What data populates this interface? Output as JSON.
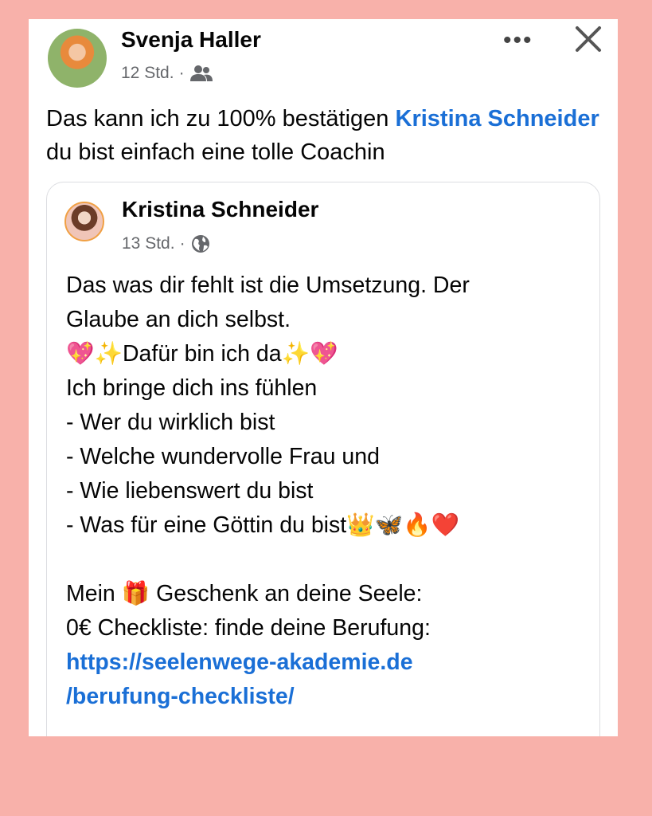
{
  "post": {
    "author": "Svenja Haller",
    "time": "12 Std.",
    "separator": "·",
    "audience_icon": "friends-icon",
    "more_icon": "more-horizontal-icon",
    "more_label": "•••",
    "close_icon": "close-icon",
    "text_before": "Das kann ich zu 100% bestätigen ",
    "mention": "Kristina Schneider",
    "text_after": " du bist einfach eine tolle Coachin"
  },
  "shared": {
    "author": "Kristina Schneider",
    "time": "13 Std.",
    "separator": "·",
    "audience_icon": "globe-icon",
    "lines": [
      "Das was dir fehlt ist die Umsetzung. Der",
      "Glaube an dich selbst.",
      "💖✨Dafür bin ich da✨💖",
      "Ich bringe dich ins fühlen",
      "- Wer du wirklich bist",
      "- Welche wundervolle Frau und",
      "- Wie liebenswert du bist",
      "- Was für eine Göttin du bist👑🦋🔥❤️",
      "",
      "Mein 🎁 Geschenk an deine Seele:",
      "0€ Checkliste: finde deine Berufung:"
    ],
    "link_line1": "https://seelenwege-akademie.de",
    "link_line2": "/berufung-checkliste/"
  },
  "colors": {
    "background": "#f8b1aa",
    "link": "#1a6fd6"
  }
}
